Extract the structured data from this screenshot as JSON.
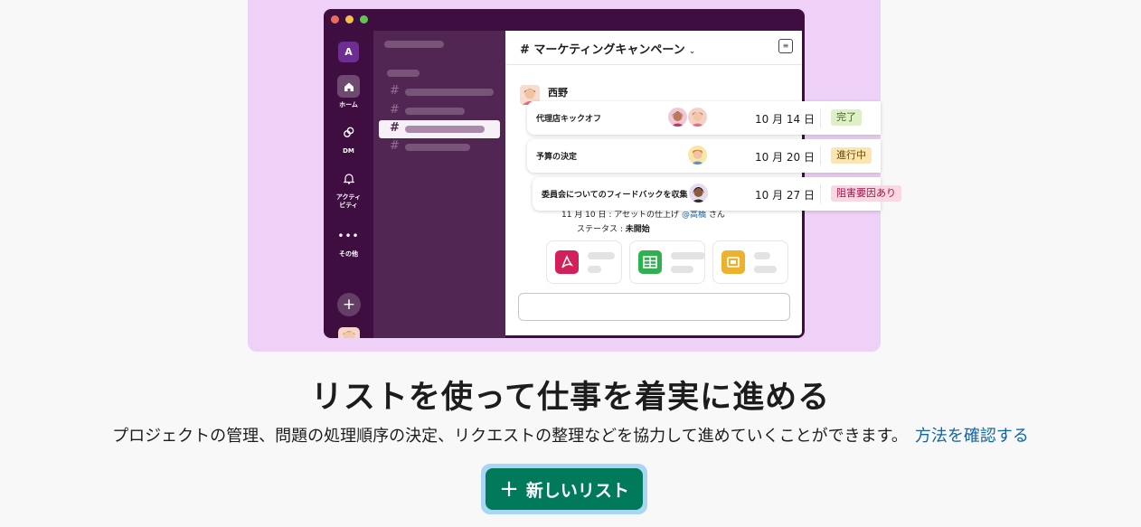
{
  "mockup": {
    "workspace_initial": "A",
    "rail": [
      {
        "label": "ホーム",
        "icon": "home-icon"
      },
      {
        "label": "DM",
        "icon": "dm-icon"
      },
      {
        "label": "アクティ\nビティ",
        "icon": "bell-icon"
      },
      {
        "label": "その他",
        "icon": "more-icon"
      }
    ],
    "channel_title": "# マーケティングキャンペーン",
    "sender": "西野",
    "list_rows": [
      {
        "name": "代理店キックオフ",
        "date": "10 月 14 日",
        "status": "完了",
        "status_color": "#dff0c8",
        "status_text_color": "#3a6b0f"
      },
      {
        "name": "予算の決定",
        "date": "10 月 20 日",
        "status": "進行中",
        "status_color": "#fbe5b3",
        "status_text_color": "#6b4a00"
      },
      {
        "name": "委員会についてのフィードバックを収集",
        "date": "10 月 27 日",
        "status": "阻害要因あり",
        "status_color": "#fbd7e2",
        "status_text_color": "#a0154a"
      }
    ],
    "meta_date_text": "11 月 10 日 : アセットの仕上げ",
    "meta_mention": "@高橋",
    "meta_suffix": "さん",
    "meta_status_label": "ステータス : ",
    "meta_status_value": "未開始",
    "files": [
      {
        "icon": "pdf-icon",
        "color": "#d31f5a"
      },
      {
        "icon": "spreadsheet-icon",
        "color": "#2eb14e"
      },
      {
        "icon": "slides-icon",
        "color": "#ecb22e"
      }
    ]
  },
  "headline": "リストを使って仕事を着実に進める",
  "description": "プロジェクトの管理、問題の処理順序の決定、リクエストの整理などを協力して進めていくことができます。",
  "learn_more_link": "方法を確認する",
  "cta_label": "新しいリスト",
  "colors": {
    "accent": "#007a5a",
    "link": "#1264a3",
    "hero_bg": "#efd0f7",
    "aubergine": "#3f0e40"
  }
}
